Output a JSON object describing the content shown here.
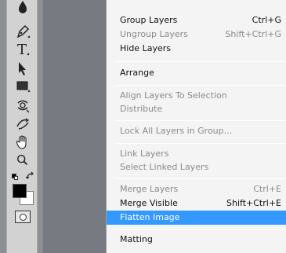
{
  "tools": [
    {
      "icon": "blur-icon"
    },
    {
      "icon": "pen-icon"
    },
    {
      "icon": "type-icon",
      "glyph": "T"
    },
    {
      "icon": "path-selection-icon"
    },
    {
      "icon": "rectangle-icon"
    },
    {
      "icon": "3d-rotate-icon"
    },
    {
      "icon": "3d-orbit-icon"
    },
    {
      "icon": "hand-icon"
    },
    {
      "icon": "zoom-icon"
    }
  ],
  "colors": {
    "foreground": "#000000",
    "background": "#ffffff",
    "highlight": "#3399ff",
    "disabled_text": "#8a8a8a"
  },
  "menu": {
    "items": [
      {
        "label": "Group Layers",
        "shortcut": "Ctrl+G",
        "enabled": true,
        "submenu": false
      },
      {
        "label": "Ungroup Layers",
        "shortcut": "Shift+Ctrl+G",
        "enabled": false,
        "submenu": false
      },
      {
        "label": "Hide Layers",
        "shortcut": "",
        "enabled": true,
        "submenu": false
      },
      {
        "label": "Arrange",
        "shortcut": "",
        "enabled": true,
        "submenu": true
      },
      {
        "label": "Align Layers To Selection",
        "shortcut": "",
        "enabled": false,
        "submenu": true
      },
      {
        "label": "Distribute",
        "shortcut": "",
        "enabled": false,
        "submenu": true
      },
      {
        "label": "Lock All Layers in Group...",
        "shortcut": "",
        "enabled": false,
        "submenu": false
      },
      {
        "label": "Link Layers",
        "shortcut": "",
        "enabled": false,
        "submenu": false
      },
      {
        "label": "Select Linked Layers",
        "shortcut": "",
        "enabled": false,
        "submenu": false
      },
      {
        "label": "Merge Layers",
        "shortcut": "Ctrl+E",
        "enabled": false,
        "submenu": false
      },
      {
        "label": "Merge Visible",
        "shortcut": "Shift+Ctrl+E",
        "enabled": true,
        "submenu": false
      },
      {
        "label": "Flatten Image",
        "shortcut": "",
        "enabled": true,
        "submenu": false,
        "highlighted": true
      },
      {
        "label": "Matting",
        "shortcut": "",
        "enabled": true,
        "submenu": true
      }
    ]
  }
}
